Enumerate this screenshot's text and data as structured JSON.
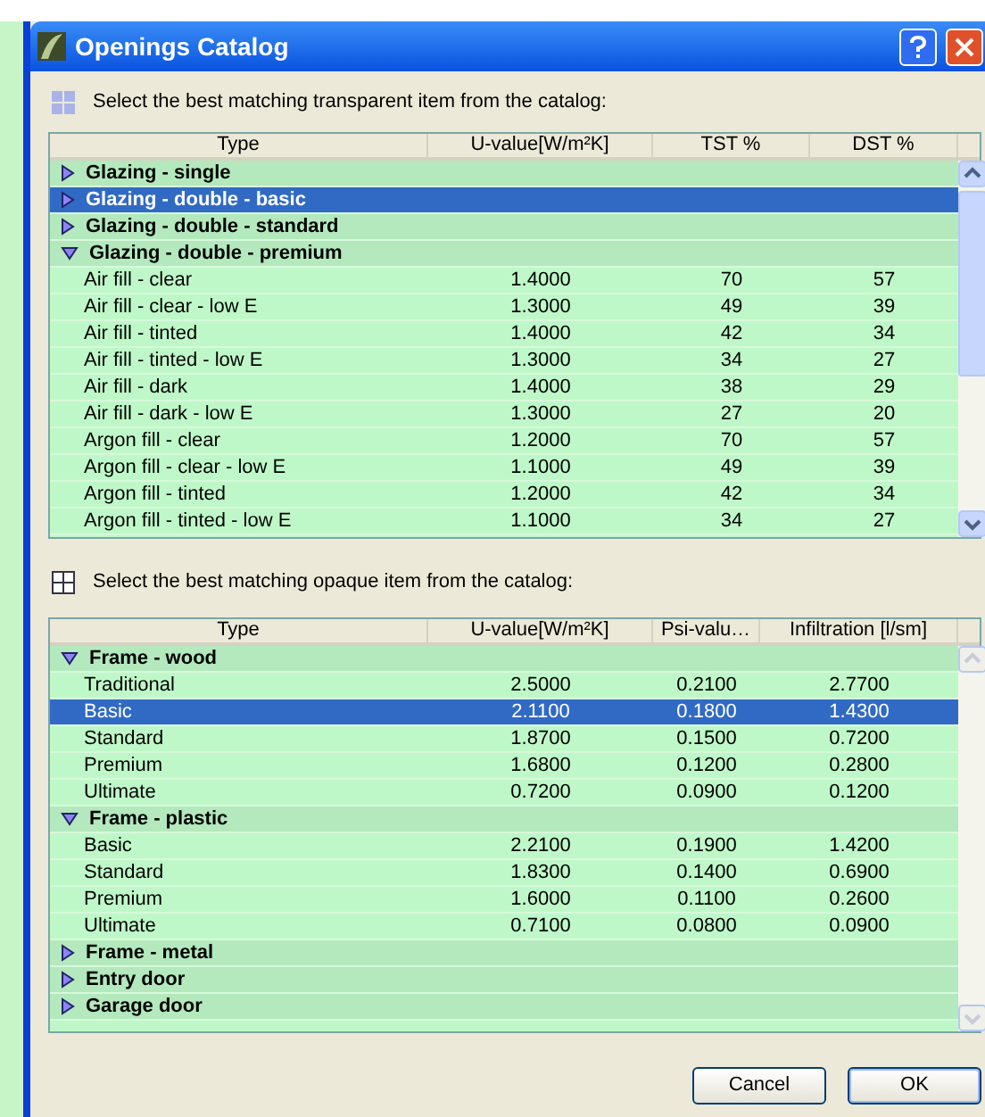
{
  "window": {
    "title": "Openings Catalog"
  },
  "transparent": {
    "prompt": "Select the best matching transparent item from the catalog:",
    "columns": [
      "Type",
      "U-value[W/m²K]",
      "TST %",
      "DST %"
    ],
    "groups": [
      {
        "label": "Glazing - single",
        "expanded": false,
        "selected": false
      },
      {
        "label": "Glazing - double - basic",
        "expanded": false,
        "selected": true
      },
      {
        "label": "Glazing - double - standard",
        "expanded": false,
        "selected": false
      },
      {
        "label": "Glazing - double - premium",
        "expanded": true,
        "selected": false,
        "children": [
          {
            "cells": [
              "Air fill - clear",
              "1.4000",
              "70",
              "57"
            ],
            "selected": false
          },
          {
            "cells": [
              "Air fill - clear - low E",
              "1.3000",
              "49",
              "39"
            ],
            "selected": false
          },
          {
            "cells": [
              "Air fill - tinted",
              "1.4000",
              "42",
              "34"
            ],
            "selected": false
          },
          {
            "cells": [
              "Air fill - tinted - low E",
              "1.3000",
              "34",
              "27"
            ],
            "selected": false
          },
          {
            "cells": [
              "Air fill - dark",
              "1.4000",
              "38",
              "29"
            ],
            "selected": false
          },
          {
            "cells": [
              "Air fill - dark - low E",
              "1.3000",
              "27",
              "20"
            ],
            "selected": false
          },
          {
            "cells": [
              "Argon fill - clear",
              "1.2000",
              "70",
              "57"
            ],
            "selected": false
          },
          {
            "cells": [
              "Argon fill - clear - low E",
              "1.1000",
              "49",
              "39"
            ],
            "selected": false
          },
          {
            "cells": [
              "Argon fill - tinted",
              "1.2000",
              "42",
              "34"
            ],
            "selected": false
          },
          {
            "cells": [
              "Argon fill - tinted - low E",
              "1.1000",
              "34",
              "27"
            ],
            "selected": false
          }
        ]
      }
    ]
  },
  "opaque": {
    "prompt": "Select the best matching opaque item from the catalog:",
    "columns": [
      "Type",
      "U-value[W/m²K]",
      "Psi-valu…",
      "Infiltration [l/sm]"
    ],
    "groups": [
      {
        "label": "Frame - wood",
        "expanded": true,
        "selected": false,
        "children": [
          {
            "cells": [
              "Traditional",
              "2.5000",
              "0.2100",
              "2.7700"
            ],
            "selected": false
          },
          {
            "cells": [
              "Basic",
              "2.1100",
              "0.1800",
              "1.4300"
            ],
            "selected": true
          },
          {
            "cells": [
              "Standard",
              "1.8700",
              "0.1500",
              "0.7200"
            ],
            "selected": false
          },
          {
            "cells": [
              "Premium",
              "1.6800",
              "0.1200",
              "0.2800"
            ],
            "selected": false
          },
          {
            "cells": [
              "Ultimate",
              "0.7200",
              "0.0900",
              "0.1200"
            ],
            "selected": false
          }
        ]
      },
      {
        "label": "Frame - plastic",
        "expanded": true,
        "selected": false,
        "children": [
          {
            "cells": [
              "Basic",
              "2.2100",
              "0.1900",
              "1.4200"
            ],
            "selected": false
          },
          {
            "cells": [
              "Standard",
              "1.8300",
              "0.1400",
              "0.6900"
            ],
            "selected": false
          },
          {
            "cells": [
              "Premium",
              "1.6000",
              "0.1100",
              "0.2600"
            ],
            "selected": false
          },
          {
            "cells": [
              "Ultimate",
              "0.7100",
              "0.0800",
              "0.0900"
            ],
            "selected": false
          }
        ]
      },
      {
        "label": "Frame - metal",
        "expanded": false,
        "selected": false
      },
      {
        "label": "Entry door",
        "expanded": false,
        "selected": false
      },
      {
        "label": "Garage door",
        "expanded": false,
        "selected": false
      }
    ]
  },
  "buttons": [
    "Cancel",
    "OK"
  ]
}
